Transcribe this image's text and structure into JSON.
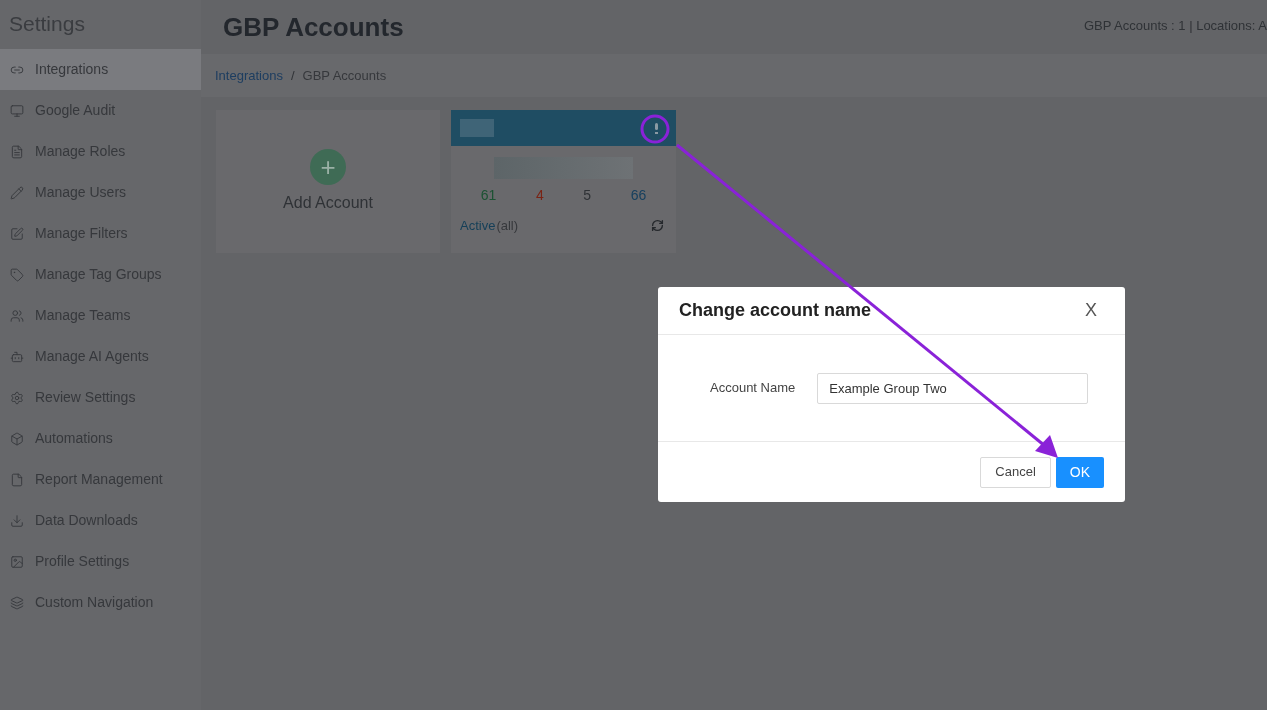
{
  "sidebar": {
    "title": "Settings",
    "items": [
      {
        "label": "Integrations",
        "selected": true
      },
      {
        "label": "Google Audit",
        "selected": false
      },
      {
        "label": "Manage Roles",
        "selected": false
      },
      {
        "label": "Manage Users",
        "selected": false
      },
      {
        "label": "Manage Filters",
        "selected": false
      },
      {
        "label": "Manage Tag Groups",
        "selected": false
      },
      {
        "label": "Manage Teams",
        "selected": false
      },
      {
        "label": "Manage AI Agents",
        "selected": false
      },
      {
        "label": "Review Settings",
        "selected": false
      },
      {
        "label": "Automations",
        "selected": false
      },
      {
        "label": "Report Management",
        "selected": false
      },
      {
        "label": "Data Downloads",
        "selected": false
      },
      {
        "label": "Profile Settings",
        "selected": false
      },
      {
        "label": "Custom Navigation",
        "selected": false
      }
    ]
  },
  "header": {
    "title": "GBP Accounts",
    "summary": "GBP Accounts : 1 | Locations: A"
  },
  "breadcrumb": [
    {
      "label": "Integrations",
      "kind": "link"
    },
    {
      "label": "/",
      "kind": "separator"
    },
    {
      "label": "GBP Accounts",
      "kind": "current"
    }
  ],
  "add_card": {
    "label": "Add Account",
    "icon": "+"
  },
  "account_card": {
    "stats": [
      {
        "value": "61",
        "color": "#1c5233"
      },
      {
        "value": "4",
        "color": "#7a2314"
      },
      {
        "value": "5",
        "color": "#2f3236"
      },
      {
        "value": "66",
        "color": "#17405e"
      }
    ],
    "status": "Active",
    "status_suffix": "(all)"
  },
  "dialog": {
    "title": "Change account name",
    "close": "X",
    "field_label": "Account Name",
    "field_value": "Example Group Two",
    "buttons": [
      {
        "label": "Cancel",
        "kind": "secondary"
      },
      {
        "label": "OK",
        "kind": "primary"
      }
    ]
  }
}
